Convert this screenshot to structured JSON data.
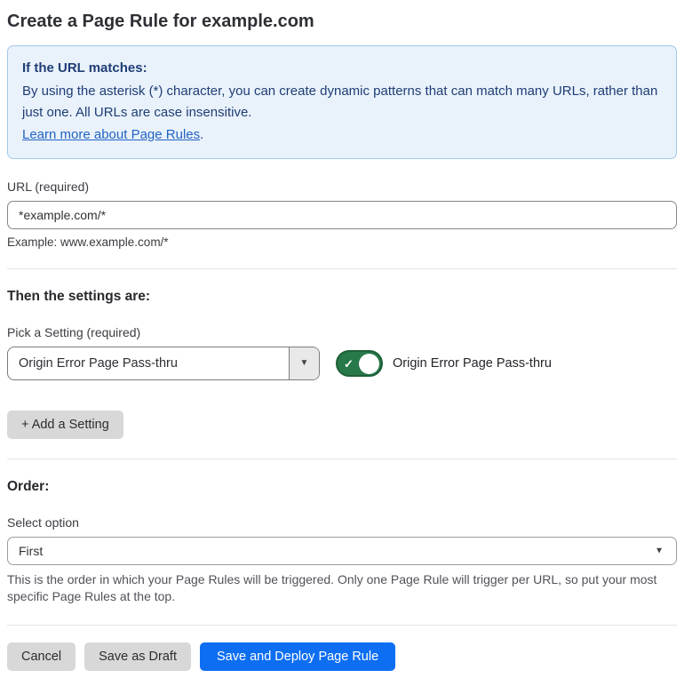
{
  "page": {
    "title": "Create a Page Rule for example.com"
  },
  "info_box": {
    "heading": "If the URL matches:",
    "body": "By using the asterisk (*) character, you can create dynamic patterns that can match many URLs, rather than just one. All URLs are case insensitive.",
    "link_label": "Learn more about Page Rules",
    "link_suffix": "."
  },
  "url_field": {
    "label": "URL (required)",
    "value": "*example.com/*",
    "example": "Example: www.example.com/*"
  },
  "settings_section": {
    "heading": "Then the settings are:",
    "picker_label": "Pick a Setting (required)",
    "picker_value": "Origin Error Page Pass-thru",
    "toggle_state": "on",
    "toggle_label": "Origin Error Page Pass-thru",
    "add_setting_button": "+ Add a Setting"
  },
  "order_section": {
    "heading": "Order:",
    "select_label": "Select option",
    "select_value": "First",
    "help_text": "This is the order in which your Page Rules will be triggered. Only one Page Rule will trigger per URL, so put your most specific Page Rules at the top."
  },
  "footer": {
    "cancel_label": "Cancel",
    "save_draft_label": "Save as Draft",
    "save_deploy_label": "Save and Deploy Page Rule"
  },
  "icons": {
    "check": "✓",
    "caret": "▼"
  },
  "colors": {
    "info_bg": "#e9f2fb",
    "info_border": "#a3c7ea",
    "info_text": "#1f3d75",
    "link_blue": "#2263c3",
    "toggle_green": "#27794a",
    "primary_blue": "#0d6ef2",
    "button_gray": "#d8d8d8"
  }
}
